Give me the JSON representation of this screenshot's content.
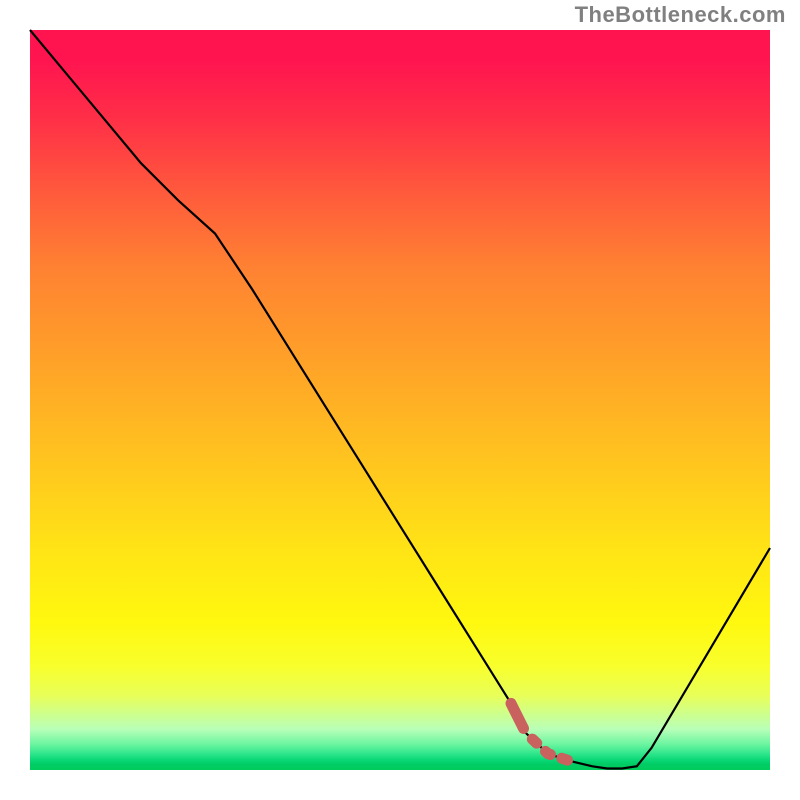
{
  "watermark": "TheBottleneck.com",
  "colors": {
    "curve": "#000000",
    "highlight": "#c9615e",
    "gradient_top": "#ff1450",
    "gradient_bottom": "#00cc5a"
  },
  "chart_data": {
    "type": "line",
    "title": "",
    "xlabel": "",
    "ylabel": "",
    "xlim": [
      0,
      100
    ],
    "ylim": [
      0,
      100
    ],
    "series": [
      {
        "name": "bottleneck-curve",
        "x": [
          0,
          5,
          10,
          15,
          20,
          25,
          30,
          35,
          40,
          45,
          50,
          55,
          60,
          65,
          67,
          70,
          73,
          76,
          78,
          80,
          82,
          84,
          100
        ],
        "y": [
          100,
          94,
          88,
          82,
          77,
          72.5,
          65,
          57,
          49,
          41,
          33,
          25,
          17,
          9,
          5,
          2.2,
          1.2,
          0.5,
          0.2,
          0.2,
          0.5,
          3,
          30
        ]
      }
    ],
    "highlight_segment": {
      "name": "optimal-range",
      "style": "dashed-thick",
      "x": [
        65,
        67,
        70,
        73,
        76,
        78,
        80
      ],
      "y": [
        9,
        5,
        2.2,
        1.2,
        0.5,
        0.2,
        0.2
      ]
    }
  }
}
